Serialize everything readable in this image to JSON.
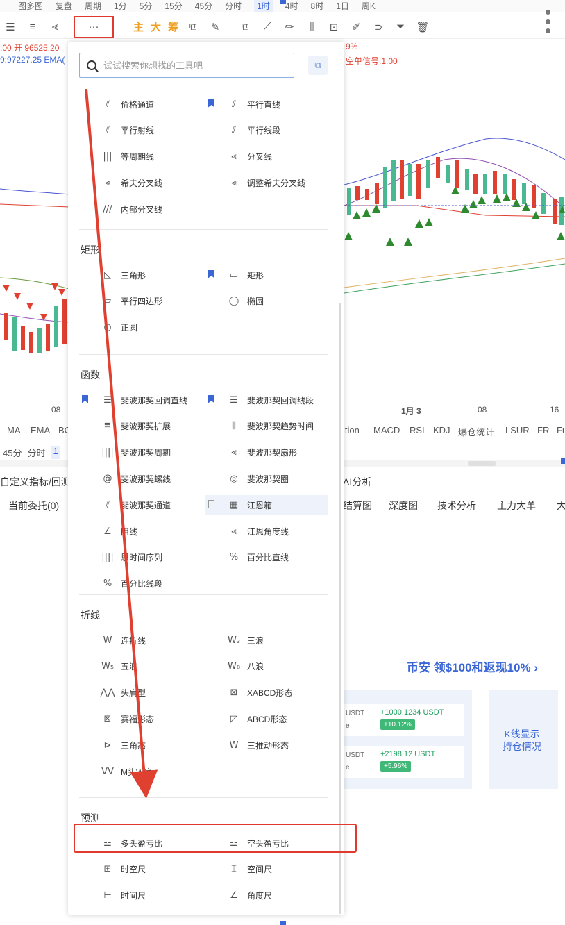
{
  "top_bar": {
    "items": [
      "图多图",
      "复盘",
      "周期",
      "1分",
      "5分",
      "15分",
      "45分",
      "分时"
    ],
    "periods": [
      "1时",
      "4时",
      "8时",
      "1日",
      "周K"
    ],
    "active_period": "1时"
  },
  "toolbar": {
    "text_buttons": [
      "主",
      "大",
      "筹"
    ],
    "more_label": "···"
  },
  "info": {
    "line1_left": ":00 开 96525.20",
    "line1_right": "9%",
    "line2_left": "9:97227.25 EMA(",
    "line2_right": "空单信号:1.00"
  },
  "x_axis": [
    "08",
    "1月 3",
    "08",
    "16"
  ],
  "indicator_tabs_left": [
    "MA",
    "EMA",
    "BO"
  ],
  "indicator_tabs_right": [
    "ition",
    "MACD",
    "RSI",
    "KDJ",
    "爆仓统计",
    "LSUR",
    "FR",
    "Fu"
  ],
  "time_tabs": [
    "45分",
    "分时",
    "1"
  ],
  "sub_tabs_1": {
    "left": "自定义指标/回测",
    "right": "AI分析"
  },
  "sub_tabs_2": {
    "left": "当前委托(0)",
    "right": [
      "结算图",
      "深度图",
      "技术分析",
      "主力大单",
      "大"
    ]
  },
  "promo": {
    "text": "币安 领$100和返现10%",
    "chevron": "›"
  },
  "cards": [
    {
      "symbol": "USDT",
      "sub": "e",
      "pnl": "+1000.1234 USDT",
      "pct": "+10.12%"
    },
    {
      "symbol": "USDT",
      "sub": "e",
      "pnl": "+2198.12 USDT",
      "pct": "+5.96%"
    }
  ],
  "kline_box": {
    "line1": "K线显示",
    "line2": "持仓情况"
  },
  "popup": {
    "search_placeholder": "试试搜索你想找的工具吧",
    "sections": [
      {
        "title": "",
        "items": [
          {
            "label": "价格通道",
            "icon": "price-channel-icon",
            "glyph": "⫽",
            "bookmarked": false
          },
          {
            "label": "平行直线",
            "icon": "parallel-line-icon",
            "glyph": "⫽",
            "bookmarked": true
          },
          {
            "label": "平行射线",
            "icon": "parallel-ray-icon",
            "glyph": "⫽",
            "bookmarked": false
          },
          {
            "label": "平行线段",
            "icon": "parallel-segment-icon",
            "glyph": "⫽",
            "bookmarked": false
          },
          {
            "label": "等周期线",
            "icon": "cycle-lines-icon",
            "glyph": "|||",
            "bookmarked": false
          },
          {
            "label": "分叉线",
            "icon": "pitchfork-icon",
            "glyph": "⪡",
            "bookmarked": false
          },
          {
            "label": "希夫分叉线",
            "icon": "schiff-pitchfork-icon",
            "glyph": "⪡",
            "bookmarked": false
          },
          {
            "label": "调整希夫分叉线",
            "icon": "modified-schiff-icon",
            "glyph": "⪡",
            "bookmarked": false
          },
          {
            "label": "内部分叉线",
            "icon": "inside-pitchfork-icon",
            "glyph": "///",
            "bookmarked": false
          }
        ]
      },
      {
        "title": "矩形",
        "items": [
          {
            "label": "三角形",
            "icon": "triangle-icon",
            "glyph": "◺",
            "bookmarked": false
          },
          {
            "label": "矩形",
            "icon": "rectangle-icon",
            "glyph": "▭",
            "bookmarked": true
          },
          {
            "label": "平行四边形",
            "icon": "parallelogram-icon",
            "glyph": "▱",
            "bookmarked": false
          },
          {
            "label": "椭圆",
            "icon": "ellipse-icon",
            "glyph": "◯",
            "bookmarked": false
          },
          {
            "label": "正圆",
            "icon": "circle-icon",
            "glyph": "○",
            "bookmarked": false
          }
        ]
      },
      {
        "title": "函数",
        "items": [
          {
            "label": "斐波那契回调直线",
            "icon": "fib-retracement-line-icon",
            "glyph": "☰",
            "bookmarked": true
          },
          {
            "label": "斐波那契回调线段",
            "icon": "fib-retracement-segment-icon",
            "glyph": "☰",
            "bookmarked": true
          },
          {
            "label": "斐波那契扩展",
            "icon": "fib-extension-icon",
            "glyph": "≣",
            "bookmarked": false
          },
          {
            "label": "斐波那契趋势时间",
            "icon": "fib-trend-time-icon",
            "glyph": "⫼",
            "bookmarked": false
          },
          {
            "label": "斐波那契周期",
            "icon": "fib-time-zone-icon",
            "glyph": "||||",
            "bookmarked": false
          },
          {
            "label": "斐波那契扇形",
            "icon": "fib-fan-icon",
            "glyph": "⪡",
            "bookmarked": false
          },
          {
            "label": "斐波那契螺线",
            "icon": "fib-spiral-icon",
            "glyph": "@",
            "bookmarked": false
          },
          {
            "label": "斐波那契圈",
            "icon": "fib-circles-icon",
            "glyph": "◎",
            "bookmarked": false
          },
          {
            "label": "斐波那契通道",
            "icon": "fib-channel-icon",
            "glyph": "⫽",
            "bookmarked": false
          },
          {
            "label": "江恩箱",
            "icon": "gann-box-icon",
            "glyph": "▦",
            "bookmarked": false,
            "highlighted": true
          },
          {
            "label": "阻线",
            "icon": "resistance-line-icon",
            "glyph": "∠",
            "bookmarked": false
          },
          {
            "label": "江恩角度线",
            "icon": "gann-angle-icon",
            "glyph": "⪡",
            "bookmarked": false
          },
          {
            "label": "恩时间序列",
            "icon": "gann-time-series-icon",
            "glyph": "||||",
            "bookmarked": false
          },
          {
            "label": "百分比直线",
            "icon": "percent-line-icon",
            "glyph": "%",
            "bookmarked": false
          },
          {
            "label": "百分比线段",
            "icon": "percent-segment-icon",
            "glyph": "%",
            "bookmarked": false
          }
        ]
      },
      {
        "title": "折线",
        "items": [
          {
            "label": "连折线",
            "icon": "polyline-icon",
            "glyph": "W",
            "bookmarked": false
          },
          {
            "label": "三浪",
            "icon": "three-wave-icon",
            "glyph": "W₃",
            "bookmarked": false
          },
          {
            "label": "五浪",
            "icon": "five-wave-icon",
            "glyph": "W₅",
            "bookmarked": false
          },
          {
            "label": "八浪",
            "icon": "eight-wave-icon",
            "glyph": "W₈",
            "bookmarked": false
          },
          {
            "label": "头肩型",
            "icon": "head-shoulders-icon",
            "glyph": "⋀⋀",
            "bookmarked": false
          },
          {
            "label": "XABCD形态",
            "icon": "xabcd-icon",
            "glyph": "⊠",
            "bookmarked": false
          },
          {
            "label": "赛福形态",
            "icon": "cypher-icon",
            "glyph": "⊠",
            "bookmarked": false
          },
          {
            "label": "ABCD形态",
            "icon": "abcd-icon",
            "glyph": "◸",
            "bookmarked": false
          },
          {
            "label": "三角态",
            "icon": "triangle-pattern-icon",
            "glyph": "⊳",
            "bookmarked": false
          },
          {
            "label": "三推动形态",
            "icon": "three-drives-icon",
            "glyph": "W",
            "bookmarked": false
          },
          {
            "label": "M头W底",
            "icon": "m-top-w-bottom-icon",
            "glyph": "VV",
            "bookmarked": false
          }
        ]
      },
      {
        "title": "预测",
        "items": [
          {
            "label": "多头盈亏比",
            "icon": "long-position-icon",
            "glyph": "⚍",
            "bookmarked": false
          },
          {
            "label": "空头盈亏比",
            "icon": "short-position-icon",
            "glyph": "⚍",
            "bookmarked": false
          },
          {
            "label": "时空尺",
            "icon": "date-price-range-icon",
            "glyph": "⊞",
            "bookmarked": false
          },
          {
            "label": "空间尺",
            "icon": "price-range-icon",
            "glyph": "⌶",
            "bookmarked": false
          },
          {
            "label": "时间尺",
            "icon": "date-range-icon",
            "glyph": "⊢",
            "bookmarked": false
          },
          {
            "label": "角度尺",
            "icon": "angle-ruler-icon",
            "glyph": "∠",
            "bookmarked": false
          }
        ]
      }
    ]
  }
}
